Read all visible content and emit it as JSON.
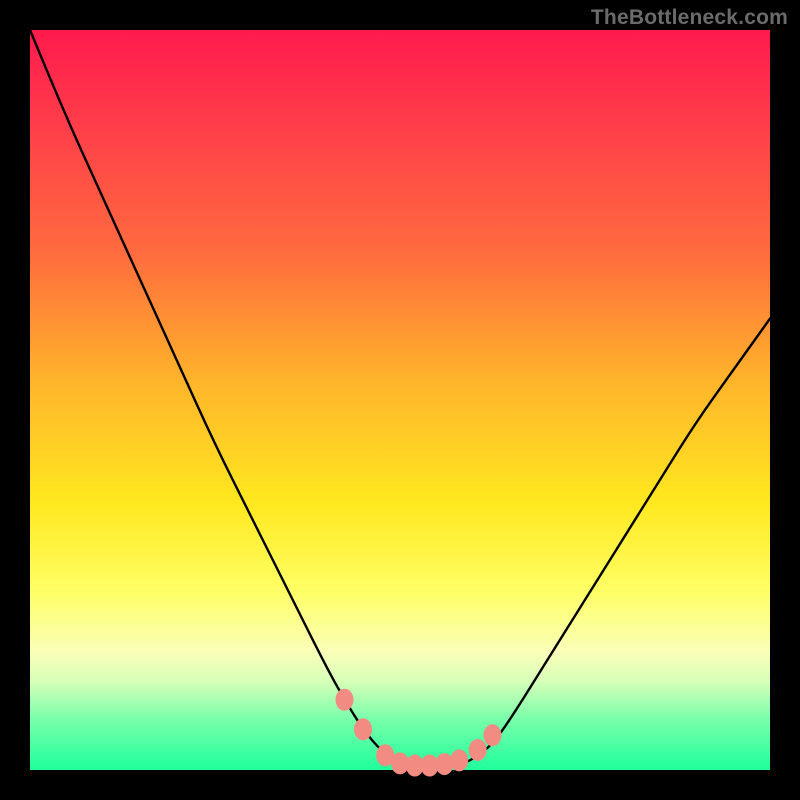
{
  "watermark": "TheBottleneck.com",
  "colors": {
    "background": "#000000",
    "gradient_top": "#ff1a4d",
    "gradient_bottom": "#1fff9b",
    "curve": "#000000",
    "marker": "#f28b82"
  },
  "chart_data": {
    "type": "line",
    "title": "",
    "xlabel": "",
    "ylabel": "",
    "xlim": [
      0,
      1
    ],
    "ylim": [
      0,
      1
    ],
    "x": [
      0.0,
      0.05,
      0.1,
      0.15,
      0.2,
      0.25,
      0.3,
      0.35,
      0.4,
      0.425,
      0.45,
      0.475,
      0.5,
      0.525,
      0.55,
      0.575,
      0.6,
      0.625,
      0.65,
      0.7,
      0.75,
      0.8,
      0.85,
      0.9,
      0.95,
      1.0
    ],
    "series": [
      {
        "name": "bottleneck-curve",
        "values": [
          1.0,
          0.88,
          0.77,
          0.66,
          0.55,
          0.44,
          0.34,
          0.24,
          0.14,
          0.095,
          0.055,
          0.025,
          0.01,
          0.005,
          0.005,
          0.005,
          0.015,
          0.035,
          0.07,
          0.15,
          0.23,
          0.31,
          0.39,
          0.47,
          0.54,
          0.61
        ]
      }
    ],
    "markers": {
      "name": "highlight-dots",
      "x": [
        0.425,
        0.45,
        0.48,
        0.5,
        0.52,
        0.54,
        0.56,
        0.58,
        0.605,
        0.625
      ],
      "values": [
        0.095,
        0.055,
        0.02,
        0.009,
        0.006,
        0.006,
        0.008,
        0.013,
        0.027,
        0.047
      ]
    }
  }
}
